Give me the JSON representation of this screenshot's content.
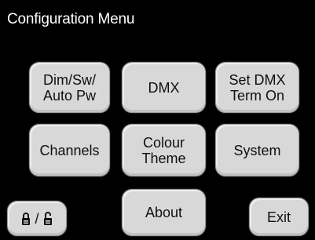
{
  "header": {
    "title": "Configuration Menu"
  },
  "grid": {
    "dim_sw": "Dim/Sw/\nAuto Pw",
    "dmx": "DMX",
    "set_dmx_term": "Set DMX\nTerm On",
    "channels": "Channels",
    "colour_theme": "Colour\nTheme",
    "system": "System"
  },
  "footer": {
    "lock_separator": "/",
    "about": "About",
    "exit": "Exit"
  },
  "icons": {
    "locked": "lock-closed-icon",
    "unlocked": "lock-open-icon"
  },
  "colors": {
    "background": "#000000",
    "button_face": "#d8d8d8",
    "button_text": "#101010",
    "title_text": "#ffffff"
  }
}
